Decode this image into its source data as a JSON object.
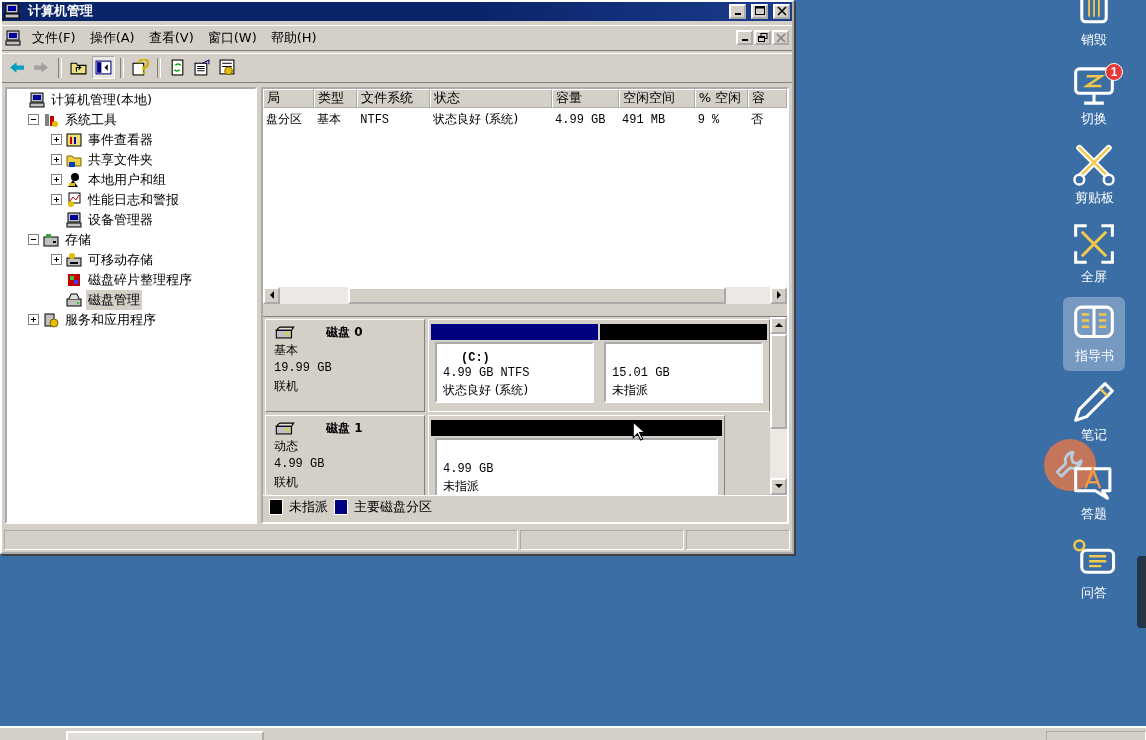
{
  "window": {
    "title": "计算机管理"
  },
  "menu": [
    "文件(F)",
    "操作(A)",
    "查看(V)",
    "窗口(W)",
    "帮助(H)"
  ],
  "toolbar": [
    {
      "kind": "back",
      "pressed": false,
      "disabled": false
    },
    {
      "kind": "forward",
      "pressed": false,
      "disabled": true
    },
    {
      "kind": "up",
      "pressed": false,
      "disabled": false
    },
    {
      "kind": "tree",
      "pressed": true,
      "disabled": false
    },
    {
      "kind": "help",
      "pressed": false,
      "disabled": false
    },
    {
      "kind": "refresh",
      "pressed": false,
      "disabled": false
    },
    {
      "kind": "export",
      "pressed": false,
      "disabled": false
    },
    {
      "kind": "properties",
      "pressed": false,
      "disabled": false
    }
  ],
  "tree": [
    {
      "label": "计算机管理(本地)",
      "kind": "computer",
      "selected": false,
      "children": [
        {
          "label": "系统工具",
          "kind": "tools",
          "expanded": true,
          "selected": false,
          "children": [
            {
              "label": "事件查看器",
              "kind": "events",
              "expanded": false,
              "selected": false
            },
            {
              "label": "共享文件夹",
              "kind": "folder",
              "expanded": false,
              "selected": false
            },
            {
              "label": "本地用户和组",
              "kind": "users",
              "expanded": false,
              "selected": false
            },
            {
              "label": "性能日志和警报",
              "kind": "chart",
              "expanded": false,
              "selected": false
            },
            {
              "label": "设备管理器",
              "kind": "computer",
              "selected": false
            }
          ]
        },
        {
          "label": "存储",
          "kind": "storage",
          "expanded": true,
          "selected": false,
          "children": [
            {
              "label": "可移动存储",
              "kind": "removable",
              "expanded": false,
              "selected": false
            },
            {
              "label": "磁盘碎片整理程序",
              "kind": "defrag",
              "selected": false
            },
            {
              "label": "磁盘管理",
              "kind": "disk",
              "selected": true
            }
          ]
        },
        {
          "label": "服务和应用程序",
          "kind": "services",
          "expanded": false,
          "selected": false
        }
      ]
    }
  ],
  "volume_list": {
    "columns": [
      "局",
      "类型",
      "文件系统",
      "状态",
      "容量",
      "空闲空间",
      "% 空闲",
      "容"
    ],
    "rows": [
      [
        "盘分区",
        "基本",
        "NTFS",
        "状态良好 (系统)",
        "4.99 GB",
        "491 MB",
        "9 %",
        "否"
      ]
    ]
  },
  "disks": [
    {
      "name": "磁盘 0",
      "type": "基本",
      "size": "19.99 GB",
      "status": "联机",
      "partitions": [
        {
          "kind": "primary",
          "label": "(C:)",
          "size": "4.99 GB NTFS",
          "status": "状态良好 (系统)"
        },
        {
          "kind": "unallocated",
          "size": "15.01 GB",
          "status": "未指派"
        }
      ]
    },
    {
      "name": "磁盘 1",
      "type": "动态",
      "size": "4.99 GB",
      "status": "联机",
      "partitions": [
        {
          "kind": "unallocated",
          "size": "4.99 GB",
          "status": "未指派"
        }
      ]
    }
  ],
  "legend": [
    {
      "kind": "unallocated",
      "label": "未指派"
    },
    {
      "kind": "primary",
      "label": "主要磁盘分区"
    }
  ],
  "sidebar": [
    {
      "kind": "trash",
      "label": "销毁",
      "selected": false
    },
    {
      "kind": "monitor",
      "label": "切换",
      "badge": "1",
      "selected": false
    },
    {
      "kind": "scissors",
      "label": "剪贴板",
      "selected": false
    },
    {
      "kind": "fullscreen",
      "label": "全屏",
      "selected": false
    },
    {
      "kind": "book",
      "label": "指导书",
      "selected": true
    },
    {
      "kind": "pencil",
      "label": "笔记",
      "selected": false
    },
    {
      "kind": "quiz",
      "label": "答题",
      "selected": false
    },
    {
      "kind": "qa",
      "label": "问答",
      "selected": false
    }
  ]
}
